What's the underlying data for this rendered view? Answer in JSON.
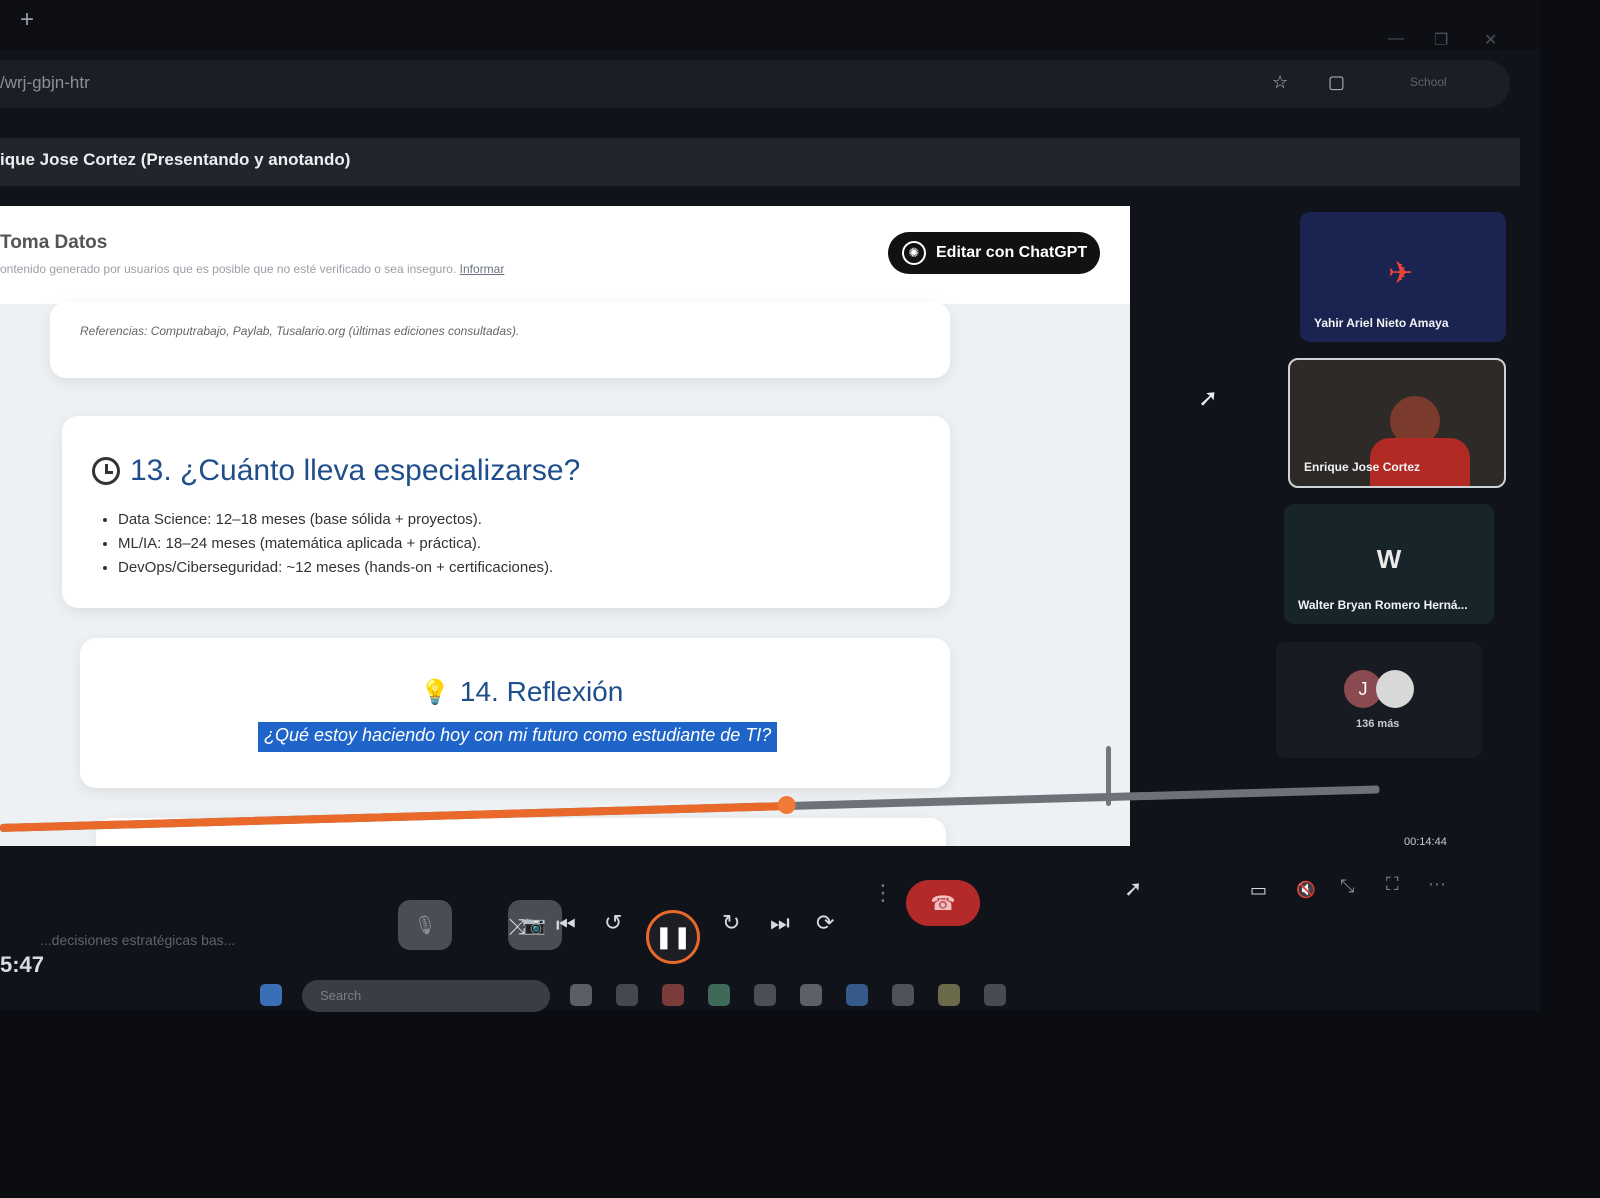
{
  "browser": {
    "new_tab_glyph": "+",
    "url_fragment": "/wrj-gbjn-htr",
    "profile_label": "School"
  },
  "meeting": {
    "presenter_title": "ique Jose Cortez (Presentando y anotando)"
  },
  "document": {
    "title": "Toma Datos",
    "warning_text": "ontenido generado por usuarios que es posible que no esté verificado o sea inseguro.",
    "warning_link": "Informar",
    "edit_button": "Editar con ChatGPT",
    "references": "Referencias: Computrabajo, Paylab, Tusalario.org (últimas ediciones consultadas).",
    "section13": {
      "title": "13. ¿Cuánto lleva especializarse?",
      "bullets": [
        "Data Science: 12–18 meses (base sólida + proyectos).",
        "ML/IA: 18–24 meses (matemática aplicada + práctica).",
        "DevOps/Ciberseguridad: ~12 meses (hands-on + certificaciones)."
      ]
    },
    "section14": {
      "title": "14. Reflexión",
      "highlighted_question": "¿Qué estoy haciendo hoy con mi futuro como estudiante de TI?"
    }
  },
  "player": {
    "progress_fraction": 0.57,
    "time_label": "00:14:44",
    "clock_partial": "5:47",
    "chat_preview": "...decisiones estratégicas bas..."
  },
  "taskbar": {
    "search_placeholder": "Search"
  },
  "participants": [
    {
      "name": "Yahir Ariel Nieto Amaya"
    },
    {
      "name": "Enrique Jose Cortez"
    },
    {
      "name": "Walter Bryan Romero Herná...",
      "initial": "W"
    },
    {
      "initial": "J",
      "more_label": "136 más"
    }
  ],
  "colors": {
    "accent_orange": "#e8692a",
    "highlight_blue": "#1f64c8",
    "title_blue": "#1f4e8c",
    "end_call_red": "#b42a2a"
  }
}
